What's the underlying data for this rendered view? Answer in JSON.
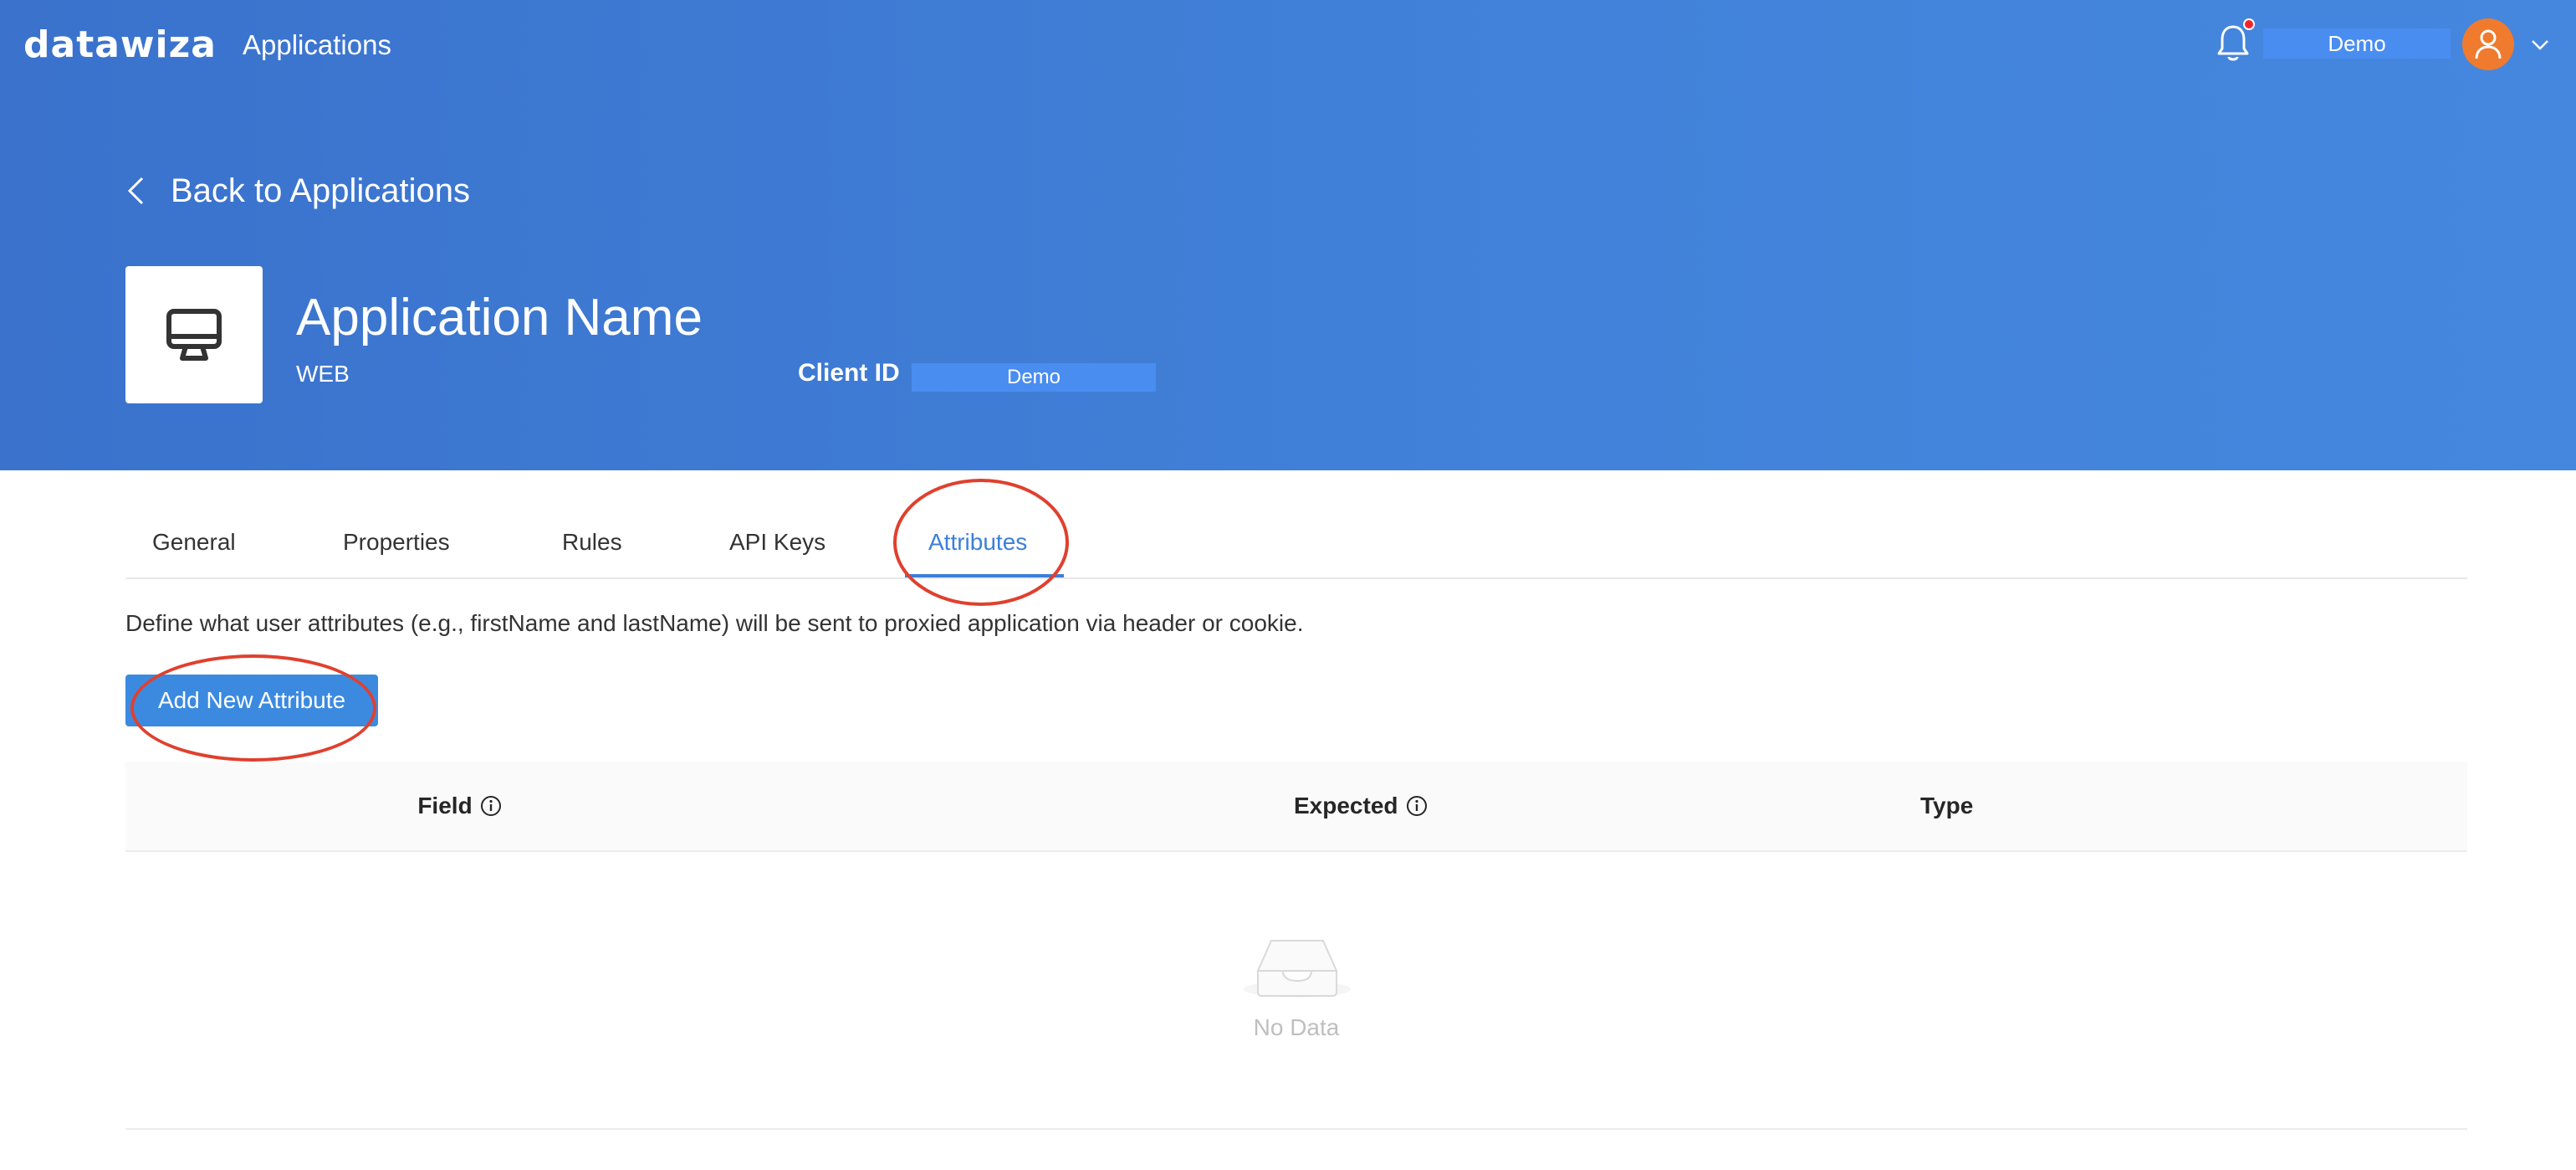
{
  "header": {
    "logo_text": "datawiza",
    "nav_title": "Applications",
    "user_name": "Demo",
    "icons": [
      "bell-icon",
      "user-icon",
      "chevron-down-icon"
    ]
  },
  "app": {
    "back_label": "Back to Applications",
    "name": "Application Name",
    "type": "WEB",
    "client_id_label": "Client ID",
    "client_id_value": "Demo",
    "icon": "monitor-icon"
  },
  "tabs": [
    {
      "label": "General",
      "active": false
    },
    {
      "label": "Properties",
      "active": false
    },
    {
      "label": "Rules",
      "active": false
    },
    {
      "label": "API Keys",
      "active": false
    },
    {
      "label": "Attributes",
      "active": true
    }
  ],
  "attributes": {
    "description": "Define what user attributes (e.g., firstName and lastName) will be sent to proxied application via header or cookie.",
    "add_button_label": "Add New Attribute",
    "columns": [
      {
        "label": "Field",
        "info": true
      },
      {
        "label": "Expected",
        "info": true
      },
      {
        "label": "Type",
        "info": false
      }
    ],
    "rows": [],
    "empty_text": "No Data"
  },
  "colors": {
    "header_bg": "#3f7ad6",
    "accent": "#3b7fd9",
    "button": "#3b8ae0",
    "annotation": "#e0402e",
    "avatar": "#f07a2e"
  }
}
